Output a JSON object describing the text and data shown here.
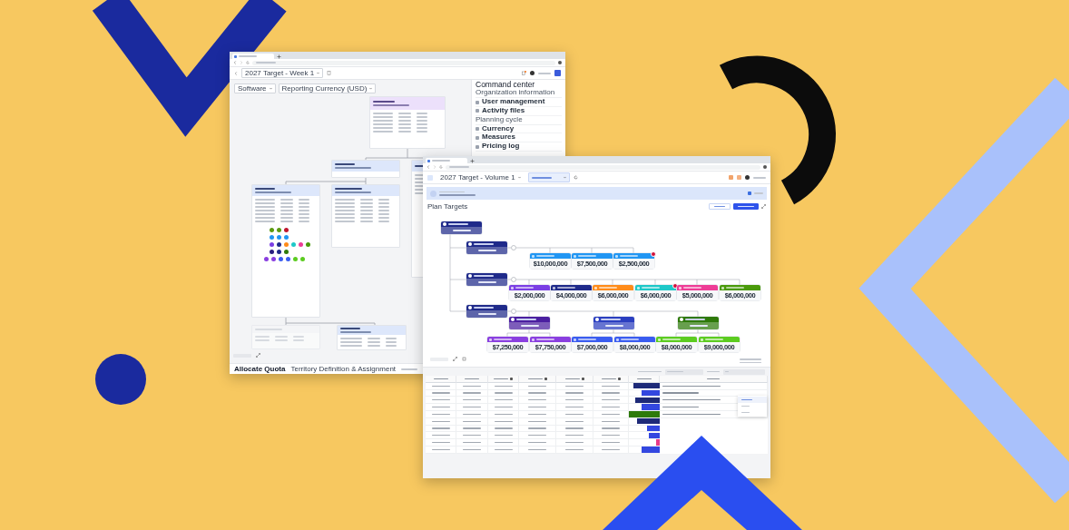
{
  "back_window": {
    "plan_select": "2027 Target - Week 1",
    "filters": [
      "Software",
      "Reporting Currency (USD)"
    ],
    "command_center": {
      "title": "Command center",
      "sections": [
        {
          "heading": "Organization information",
          "items": [
            "User management",
            "Activity files"
          ]
        },
        {
          "heading": "Planning cycle",
          "items": [
            "Currency",
            "Measures",
            "Pricing log"
          ]
        }
      ]
    },
    "bottom_bar": {
      "title": "Allocate Quota",
      "subtitle": "Territory Definition & Assignment"
    }
  },
  "front_window": {
    "plan_select": "2027 Target - Volume 1",
    "section_title": "Plan Targets",
    "tree": {
      "color": "#1f2a8a",
      "children": [
        {
          "color": "#1f2a8a",
          "children": [
            {
              "color": "#2196f3",
              "value": "$10,000,000",
              "flagged": false
            },
            {
              "color": "#2196f3",
              "value": "$7,500,000",
              "flagged": false
            },
            {
              "color": "#2196f3",
              "value": "$2,500,000",
              "flagged": true
            }
          ]
        },
        {
          "color": "#1f2a8a",
          "children": [
            {
              "color": "#7b3fe4",
              "value": "$2,000,000",
              "flagged": false
            },
            {
              "color": "#1f2a8a",
              "value": "$4,000,000",
              "flagged": false
            },
            {
              "color": "#ff8c1a",
              "value": "$6,000,000",
              "flagged": false
            },
            {
              "color": "#1ec8c8",
              "value": "$6,000,000",
              "flagged": true
            },
            {
              "color": "#ee3d96",
              "value": "$5,000,000",
              "flagged": false
            },
            {
              "color": "#4a9a0a",
              "value": "$6,000,000",
              "flagged": false
            }
          ]
        },
        {
          "color": "#1f2a8a",
          "children": [
            {
              "color": "#4b1fa0",
              "children": [
                {
                  "color": "#8a3fe0",
                  "value": "$7,250,000",
                  "flagged": false
                },
                {
                  "color": "#8a3fe0",
                  "value": "$7,750,000",
                  "flagged": false
                }
              ]
            },
            {
              "color": "#2b3fc0",
              "children": [
                {
                  "color": "#3a5cf0",
                  "value": "$7,000,000",
                  "flagged": false
                },
                {
                  "color": "#3a5cf0",
                  "value": "$8,000,000",
                  "flagged": false
                }
              ]
            },
            {
              "color": "#2f7a0a",
              "children": [
                {
                  "color": "#5ccc20",
                  "value": "$8,000,000",
                  "flagged": false
                },
                {
                  "color": "#5ccc20",
                  "value": "$9,000,000",
                  "flagged": false
                }
              ]
            }
          ]
        }
      ]
    },
    "table": {
      "rows": [
        {
          "kind": "comment",
          "allocation": {
            "level": 0.85,
            "color": "#1e2a78"
          }
        },
        {
          "kind": "comment",
          "allocation": {
            "level": 0.6,
            "color": "#3347e0"
          }
        },
        {
          "kind": "comment",
          "allocation": {
            "level": 0.8,
            "color": "#1e2a78"
          }
        },
        {
          "kind": "comment",
          "allocation": {
            "level": 0.6,
            "color": "#3347e0"
          }
        },
        {
          "kind": "comment",
          "allocation": {
            "level": 1,
            "color": "#2d7a0a"
          }
        },
        {
          "kind": "empty",
          "allocation": {
            "level": 0.75,
            "color": "#1e2a78"
          }
        },
        {
          "kind": "empty",
          "allocation": {
            "level": 0.4,
            "color": "#3347e0"
          }
        },
        {
          "kind": "empty",
          "allocation": {
            "level": 0.35,
            "color": "#3347e0"
          }
        },
        {
          "kind": "empty",
          "allocation": {
            "level": 0.12,
            "color": "#e83b8a"
          }
        },
        {
          "kind": "empty",
          "allocation": {
            "level": 0.6,
            "color": "#3347e0"
          }
        }
      ]
    },
    "comment_menu": [
      {
        "selected": true
      },
      {
        "selected": false
      },
      {
        "selected": false
      }
    ]
  }
}
